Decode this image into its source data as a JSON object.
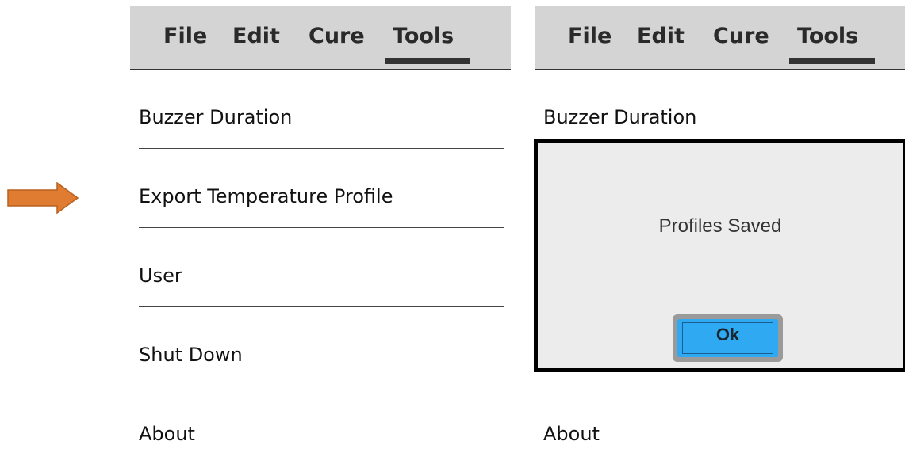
{
  "left_panel": {
    "menu": [
      "File",
      "Edit",
      "Cure",
      "Tools"
    ],
    "active_menu": "Tools",
    "rows": [
      "Buzzer Duration",
      "Export Temperature Profile",
      "User",
      "Shut Down",
      "About"
    ]
  },
  "right_panel": {
    "menu": [
      "File",
      "Edit",
      "Cure",
      "Tools"
    ],
    "active_menu": "Tools",
    "rows": [
      "Buzzer Duration",
      "About"
    ],
    "dialog": {
      "message": "Profiles Saved",
      "ok_label": "Ok"
    }
  },
  "pointer_arrow_color": "#e07b32",
  "button_color": "#2fa9f2"
}
